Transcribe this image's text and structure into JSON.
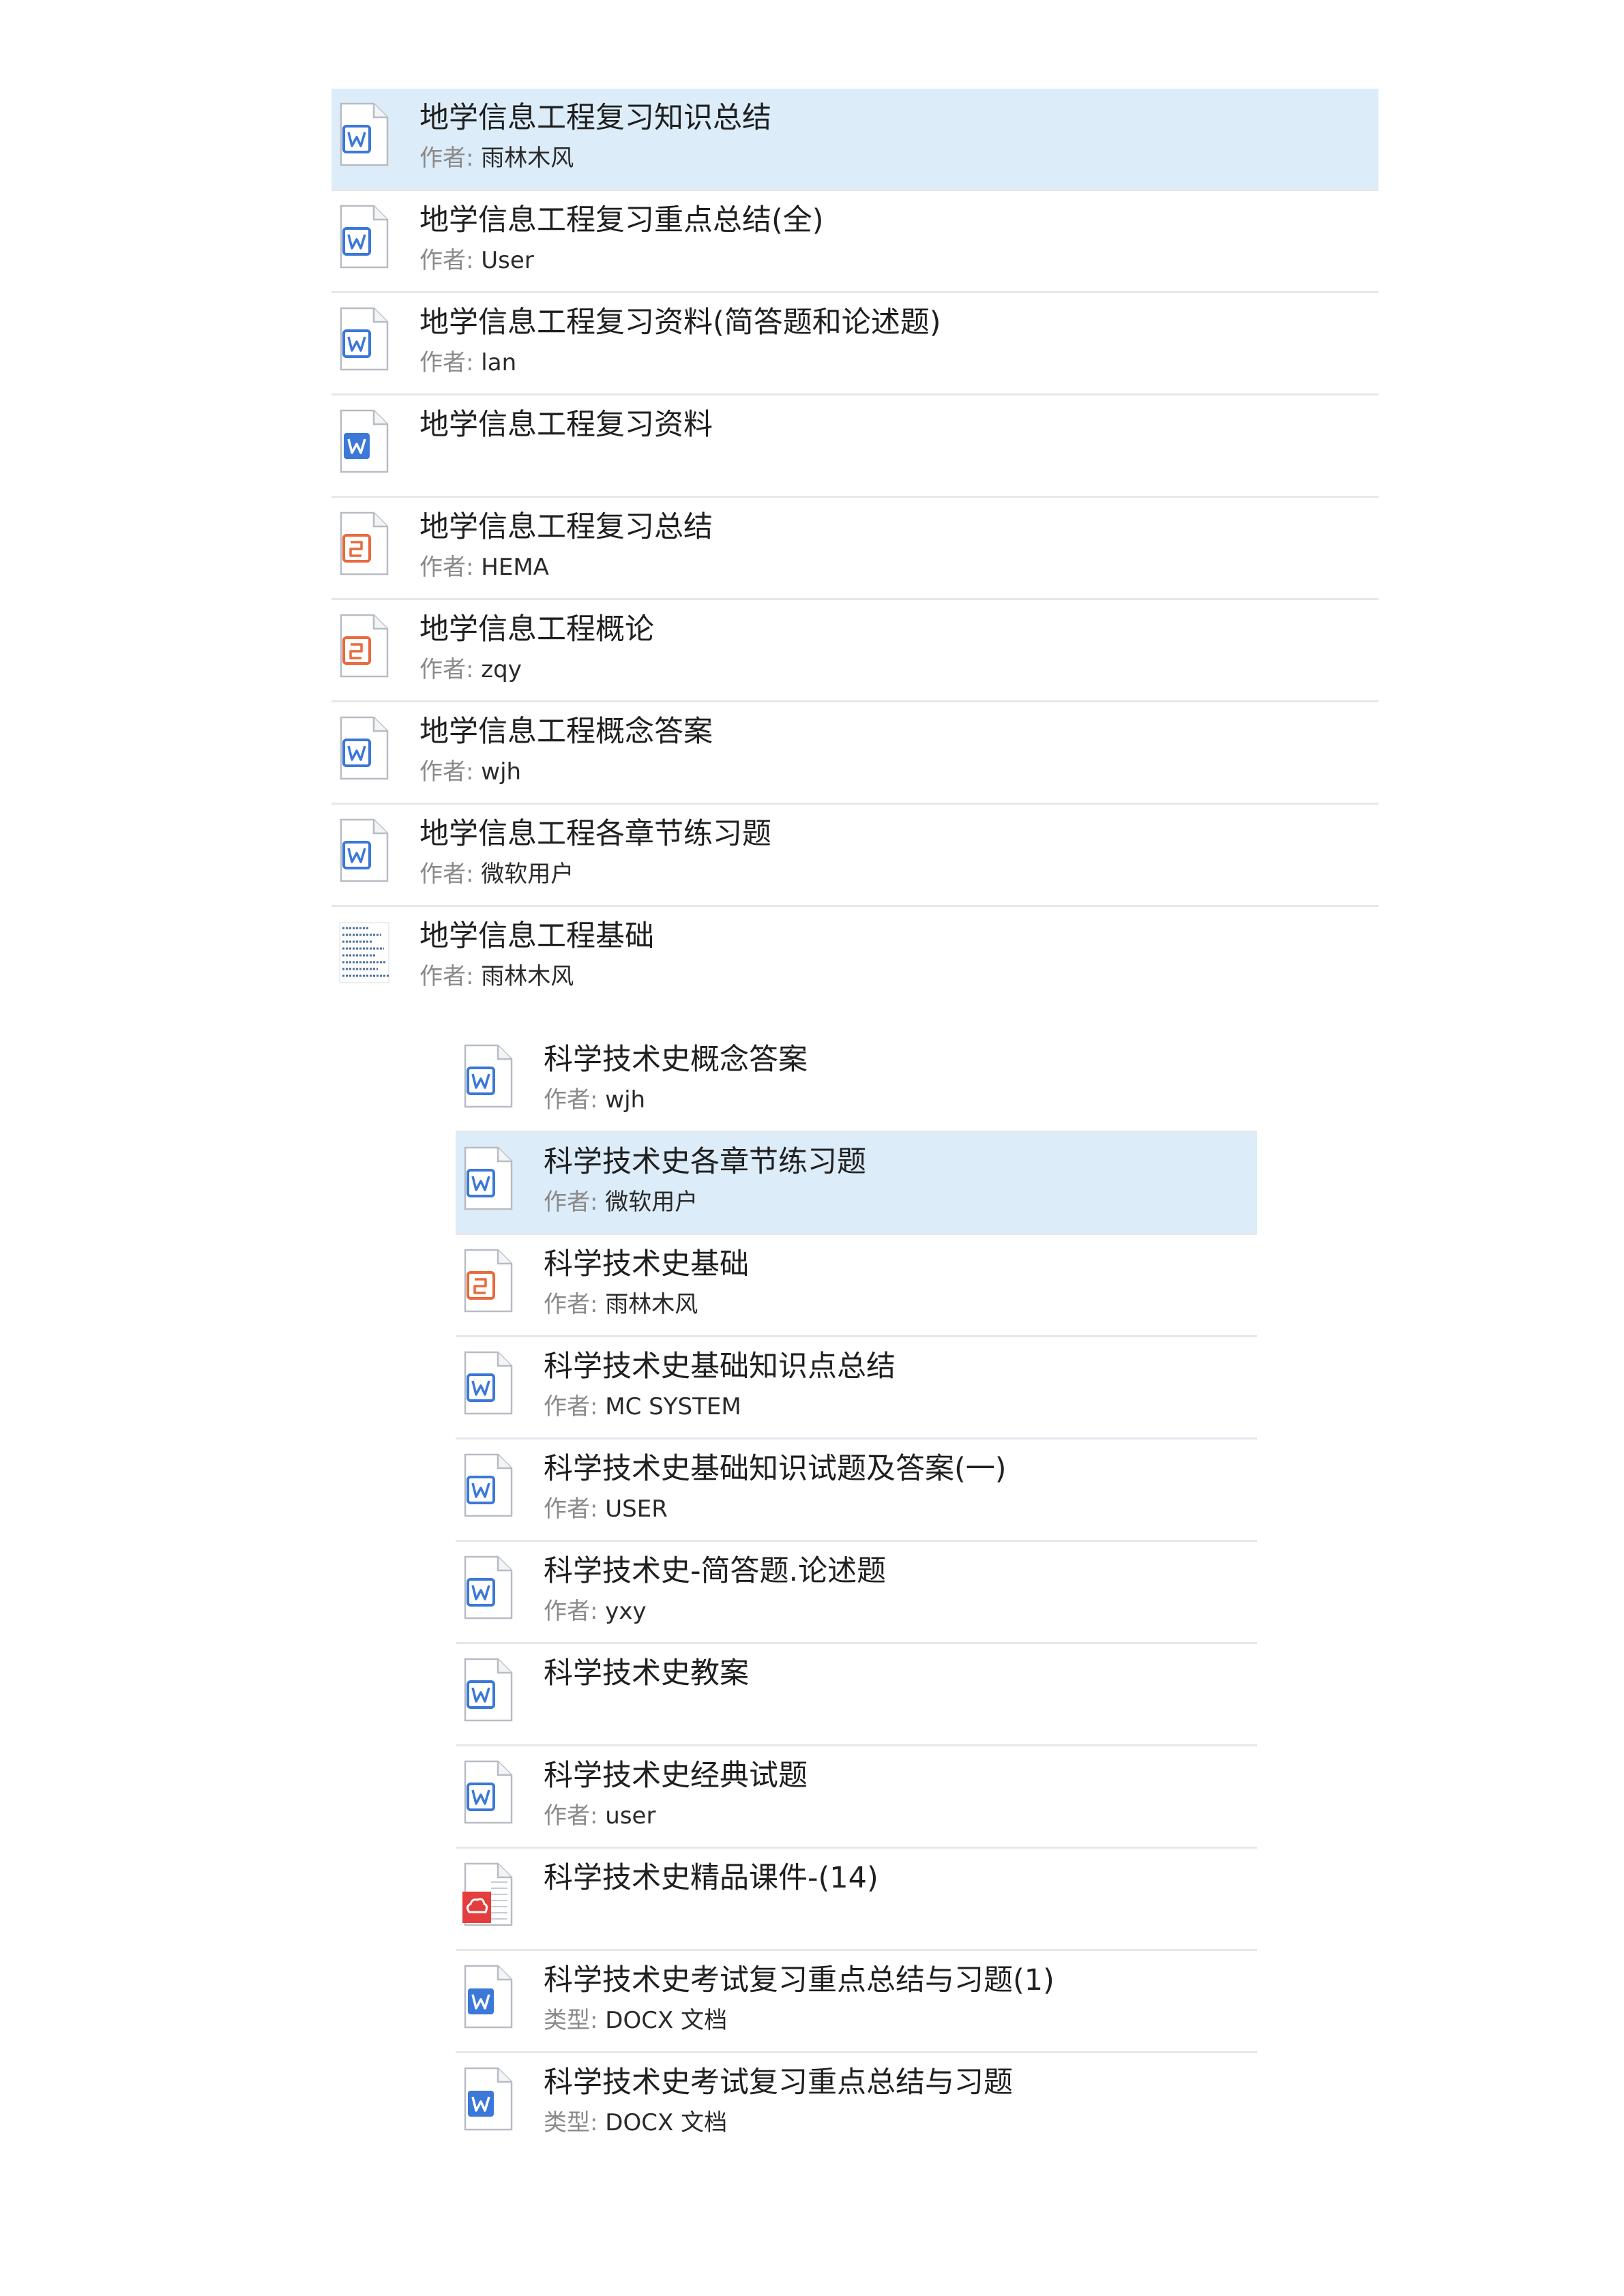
{
  "colors": {
    "word": "#3b78d8",
    "ppt": "#e96a3d",
    "pdf": "#e43d3d",
    "selected": "#dcecf8",
    "divider": "#e4e7ec"
  },
  "group1": [
    {
      "title": "地学信息工程复习知识总结",
      "meta_label": "作者:",
      "meta_value": "雨林木风",
      "icon": "word-doc-icon",
      "selected": true
    },
    {
      "title": "地学信息工程复习重点总结(全)",
      "meta_label": "作者:",
      "meta_value": "User",
      "icon": "word-doc-icon"
    },
    {
      "title": "地学信息工程复习资料(简答题和论述题)",
      "meta_label": "作者:",
      "meta_value": "lan",
      "icon": "word-doc-icon"
    },
    {
      "title": "地学信息工程复习资料",
      "icon": "word-doc-filled-icon"
    },
    {
      "title": "地学信息工程复习总结",
      "meta_label": "作者:",
      "meta_value": "HEMA",
      "icon": "ppt-doc-icon"
    },
    {
      "title": "地学信息工程概论",
      "meta_label": "作者:",
      "meta_value": "zqy",
      "icon": "ppt-doc-icon"
    },
    {
      "title": "地学信息工程概念答案",
      "meta_label": "作者:",
      "meta_value": "wjh",
      "icon": "word-doc-icon"
    },
    {
      "title": "地学信息工程各章节练习题",
      "meta_label": "作者:",
      "meta_value": "微软用户",
      "icon": "word-doc-icon"
    },
    {
      "title": "地学信息工程基础",
      "meta_label": "作者:",
      "meta_value": "雨林木风",
      "icon": "document-thumbnail-icon"
    }
  ],
  "group2": [
    {
      "title": "科学技术史概念答案",
      "meta_label": "作者:",
      "meta_value": "wjh",
      "icon": "word-doc-icon"
    },
    {
      "title": "科学技术史各章节练习题",
      "meta_label": "作者:",
      "meta_value": "微软用户",
      "icon": "word-doc-icon",
      "selected": true
    },
    {
      "title": "科学技术史基础",
      "meta_label": "作者:",
      "meta_value": "雨林木风",
      "icon": "ppt-doc-icon"
    },
    {
      "title": "科学技术史基础知识点总结",
      "meta_label": "作者:",
      "meta_value": "MC SYSTEM",
      "icon": "word-doc-icon"
    },
    {
      "title": "科学技术史基础知识试题及答案(一)",
      "meta_label": "作者:",
      "meta_value": "USER",
      "icon": "word-doc-icon"
    },
    {
      "title": "科学技术史-简答题.论述题",
      "meta_label": "作者:",
      "meta_value": "yxy",
      "icon": "word-doc-icon"
    },
    {
      "title": "科学技术史教案",
      "icon": "word-doc-icon"
    },
    {
      "title": "科学技术史经典试题",
      "meta_label": "作者:",
      "meta_value": "user",
      "icon": "word-doc-icon"
    },
    {
      "title": "科学技术史精品课件-(14)",
      "icon": "pdf-doc-icon"
    },
    {
      "title": "科学技术史考试复习重点总结与习题(1)",
      "meta_label": "类型:",
      "meta_value": "DOCX 文档",
      "icon": "word-doc-filled-icon"
    },
    {
      "title": "科学技术史考试复习重点总结与习题",
      "meta_label": "类型:",
      "meta_value": "DOCX 文档",
      "icon": "word-doc-filled-icon"
    }
  ]
}
